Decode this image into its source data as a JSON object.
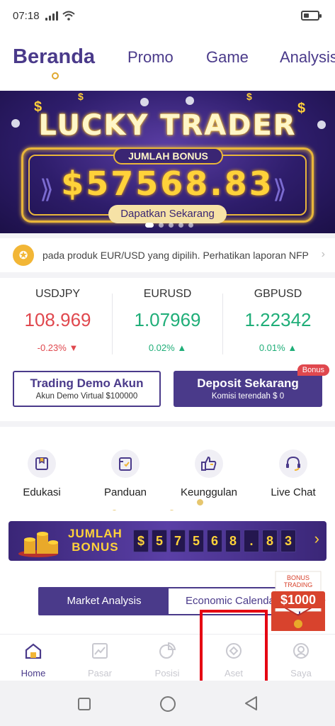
{
  "status_bar": {
    "time": "07:18"
  },
  "top_nav": {
    "tabs": [
      "Beranda",
      "Promo",
      "Game",
      "Analysis"
    ],
    "active": "Beranda"
  },
  "banner": {
    "title": "LUCKY TRADER",
    "bonus_label": "JUMLAH BONUS",
    "amount": "$57568.83",
    "cta": "Dapatkan Sekarang",
    "coin_symbol": "$",
    "slides": 5,
    "active_slide": 1
  },
  "ticker": {
    "text": "pada produk EUR/USD yang dipilih. Perhatikan laporan NFP"
  },
  "quotes": [
    {
      "symbol": "USDJPY",
      "price": "108.969",
      "change": "-0.23%",
      "direction": "down"
    },
    {
      "symbol": "EURUSD",
      "price": "1.07969",
      "change": "0.02%",
      "direction": "up"
    },
    {
      "symbol": "GBPUSD",
      "price": "1.22342",
      "change": "0.01%",
      "direction": "up"
    }
  ],
  "actions": {
    "demo": {
      "title": "Trading Demo Akun",
      "subtitle": "Akun Demo Virtual $100000"
    },
    "deposit": {
      "title": "Deposit Sekarang",
      "subtitle": "Komisi terendah $ 0",
      "badge": "Bonus"
    }
  },
  "features": [
    {
      "label": "Edukasi",
      "icon": "book-icon"
    },
    {
      "label": "Panduan",
      "icon": "guide-icon"
    },
    {
      "label": "Keunggulan",
      "icon": "thumbs-up-icon"
    },
    {
      "label": "Live Chat",
      "icon": "headset-icon"
    }
  ],
  "jackpot": {
    "label_line1": "JUMLAH",
    "label_line2": "BONUS",
    "digits": [
      "$",
      "5",
      "7",
      "5",
      "6",
      "8",
      ".",
      "8",
      "3"
    ]
  },
  "segment": {
    "tabs": [
      "Market Analysis",
      "Economic Calendar"
    ],
    "active": "Market Analysis"
  },
  "promo_badge": {
    "line1": "BONUS",
    "line2": "TRADING",
    "amount": "$1000"
  },
  "bottom_nav": [
    {
      "label": "Home",
      "icon": "home-icon",
      "active": true
    },
    {
      "label": "Pasar",
      "icon": "chart-icon",
      "active": false
    },
    {
      "label": "Posisi",
      "icon": "pie-chart-icon",
      "active": false
    },
    {
      "label": "Aset",
      "icon": "asset-icon",
      "active": false
    },
    {
      "label": "Saya",
      "icon": "user-icon",
      "active": false
    }
  ],
  "colors": {
    "brand": "#4a3a8a",
    "gold": "#ffd23a",
    "down": "#e0484e",
    "up": "#1fae78",
    "highlight": "#e50012"
  }
}
